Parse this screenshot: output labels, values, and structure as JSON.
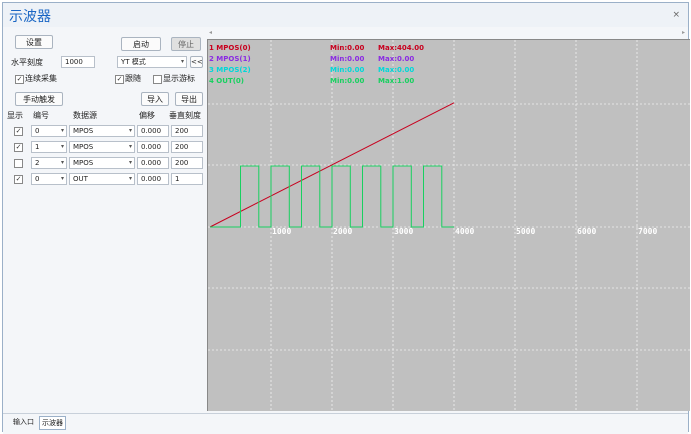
{
  "window": {
    "title": "示波器"
  },
  "toolbar": {
    "settings_label": "设置",
    "start_label": "启动",
    "stop_label": "停止",
    "h_scale_label": "水平刻度",
    "h_scale_value": "1000",
    "mode_value": "YT 模式",
    "collapse_label": "<<",
    "continuous_label": "连续采集",
    "follow_label": "跟随",
    "show_cursor_label": "显示游标",
    "manual_trigger_label": "手动触发",
    "import_label": "导入",
    "export_label": "导出"
  },
  "channel_table": {
    "headers": {
      "show": "显示",
      "index": "编号",
      "source": "数据源",
      "offset": "偏移",
      "vscale": "垂直刻度"
    },
    "rows": [
      {
        "checked": true,
        "index": "0",
        "source": "MPOS",
        "offset": "0.000",
        "vscale": "200"
      },
      {
        "checked": true,
        "index": "1",
        "source": "MPOS",
        "offset": "0.000",
        "vscale": "200"
      },
      {
        "checked": false,
        "index": "2",
        "source": "MPOS",
        "offset": "0.000",
        "vscale": "200"
      },
      {
        "checked": true,
        "index": "0",
        "source": "OUT",
        "offset": "0.000",
        "vscale": "1"
      }
    ]
  },
  "plot": {
    "legend": [
      {
        "name": "1 MPOS(0)",
        "min": "Min:0.00",
        "max": "Max:404.00",
        "color": "#c8001e"
      },
      {
        "name": "2 MPOS(1)",
        "min": "Min:0.00",
        "max": "Max:0.00",
        "color": "#8a2be2"
      },
      {
        "name": "3 MPOS(2)",
        "min": "Min:0.00",
        "max": "Max:0.00",
        "color": "#00d8d8"
      },
      {
        "name": "4 OUT(0)",
        "min": "Min:0.00",
        "max": "Max:1.00",
        "color": "#18d060"
      }
    ],
    "x_ticks": [
      "1000",
      "2000",
      "3000",
      "4000",
      "5000",
      "6000",
      "7000"
    ]
  },
  "chart_data": {
    "type": "line",
    "xlim": [
      0,
      8000
    ],
    "series": [
      {
        "name": "1 MPOS(0)",
        "x": [
          0,
          4000
        ],
        "y": [
          0,
          404
        ],
        "color": "#c8001e"
      },
      {
        "name": "4 OUT(0)",
        "color": "#18d060",
        "x": [
          0,
          500,
          500,
          800,
          800,
          1000,
          1000,
          1300,
          1300,
          1500,
          1500,
          1800,
          1800,
          2000,
          2000,
          2300,
          2300,
          2500,
          2500,
          2800,
          2800,
          3000,
          3000,
          3300,
          3300,
          3500,
          3500,
          3800,
          3800,
          4000
        ],
        "y": [
          0,
          0,
          1,
          1,
          0,
          0,
          1,
          1,
          0,
          0,
          1,
          1,
          0,
          0,
          1,
          1,
          0,
          0,
          1,
          1,
          0,
          0,
          1,
          1,
          0,
          0,
          1,
          1,
          0,
          0
        ]
      }
    ]
  },
  "tabs": [
    "输入口",
    "示波器"
  ]
}
